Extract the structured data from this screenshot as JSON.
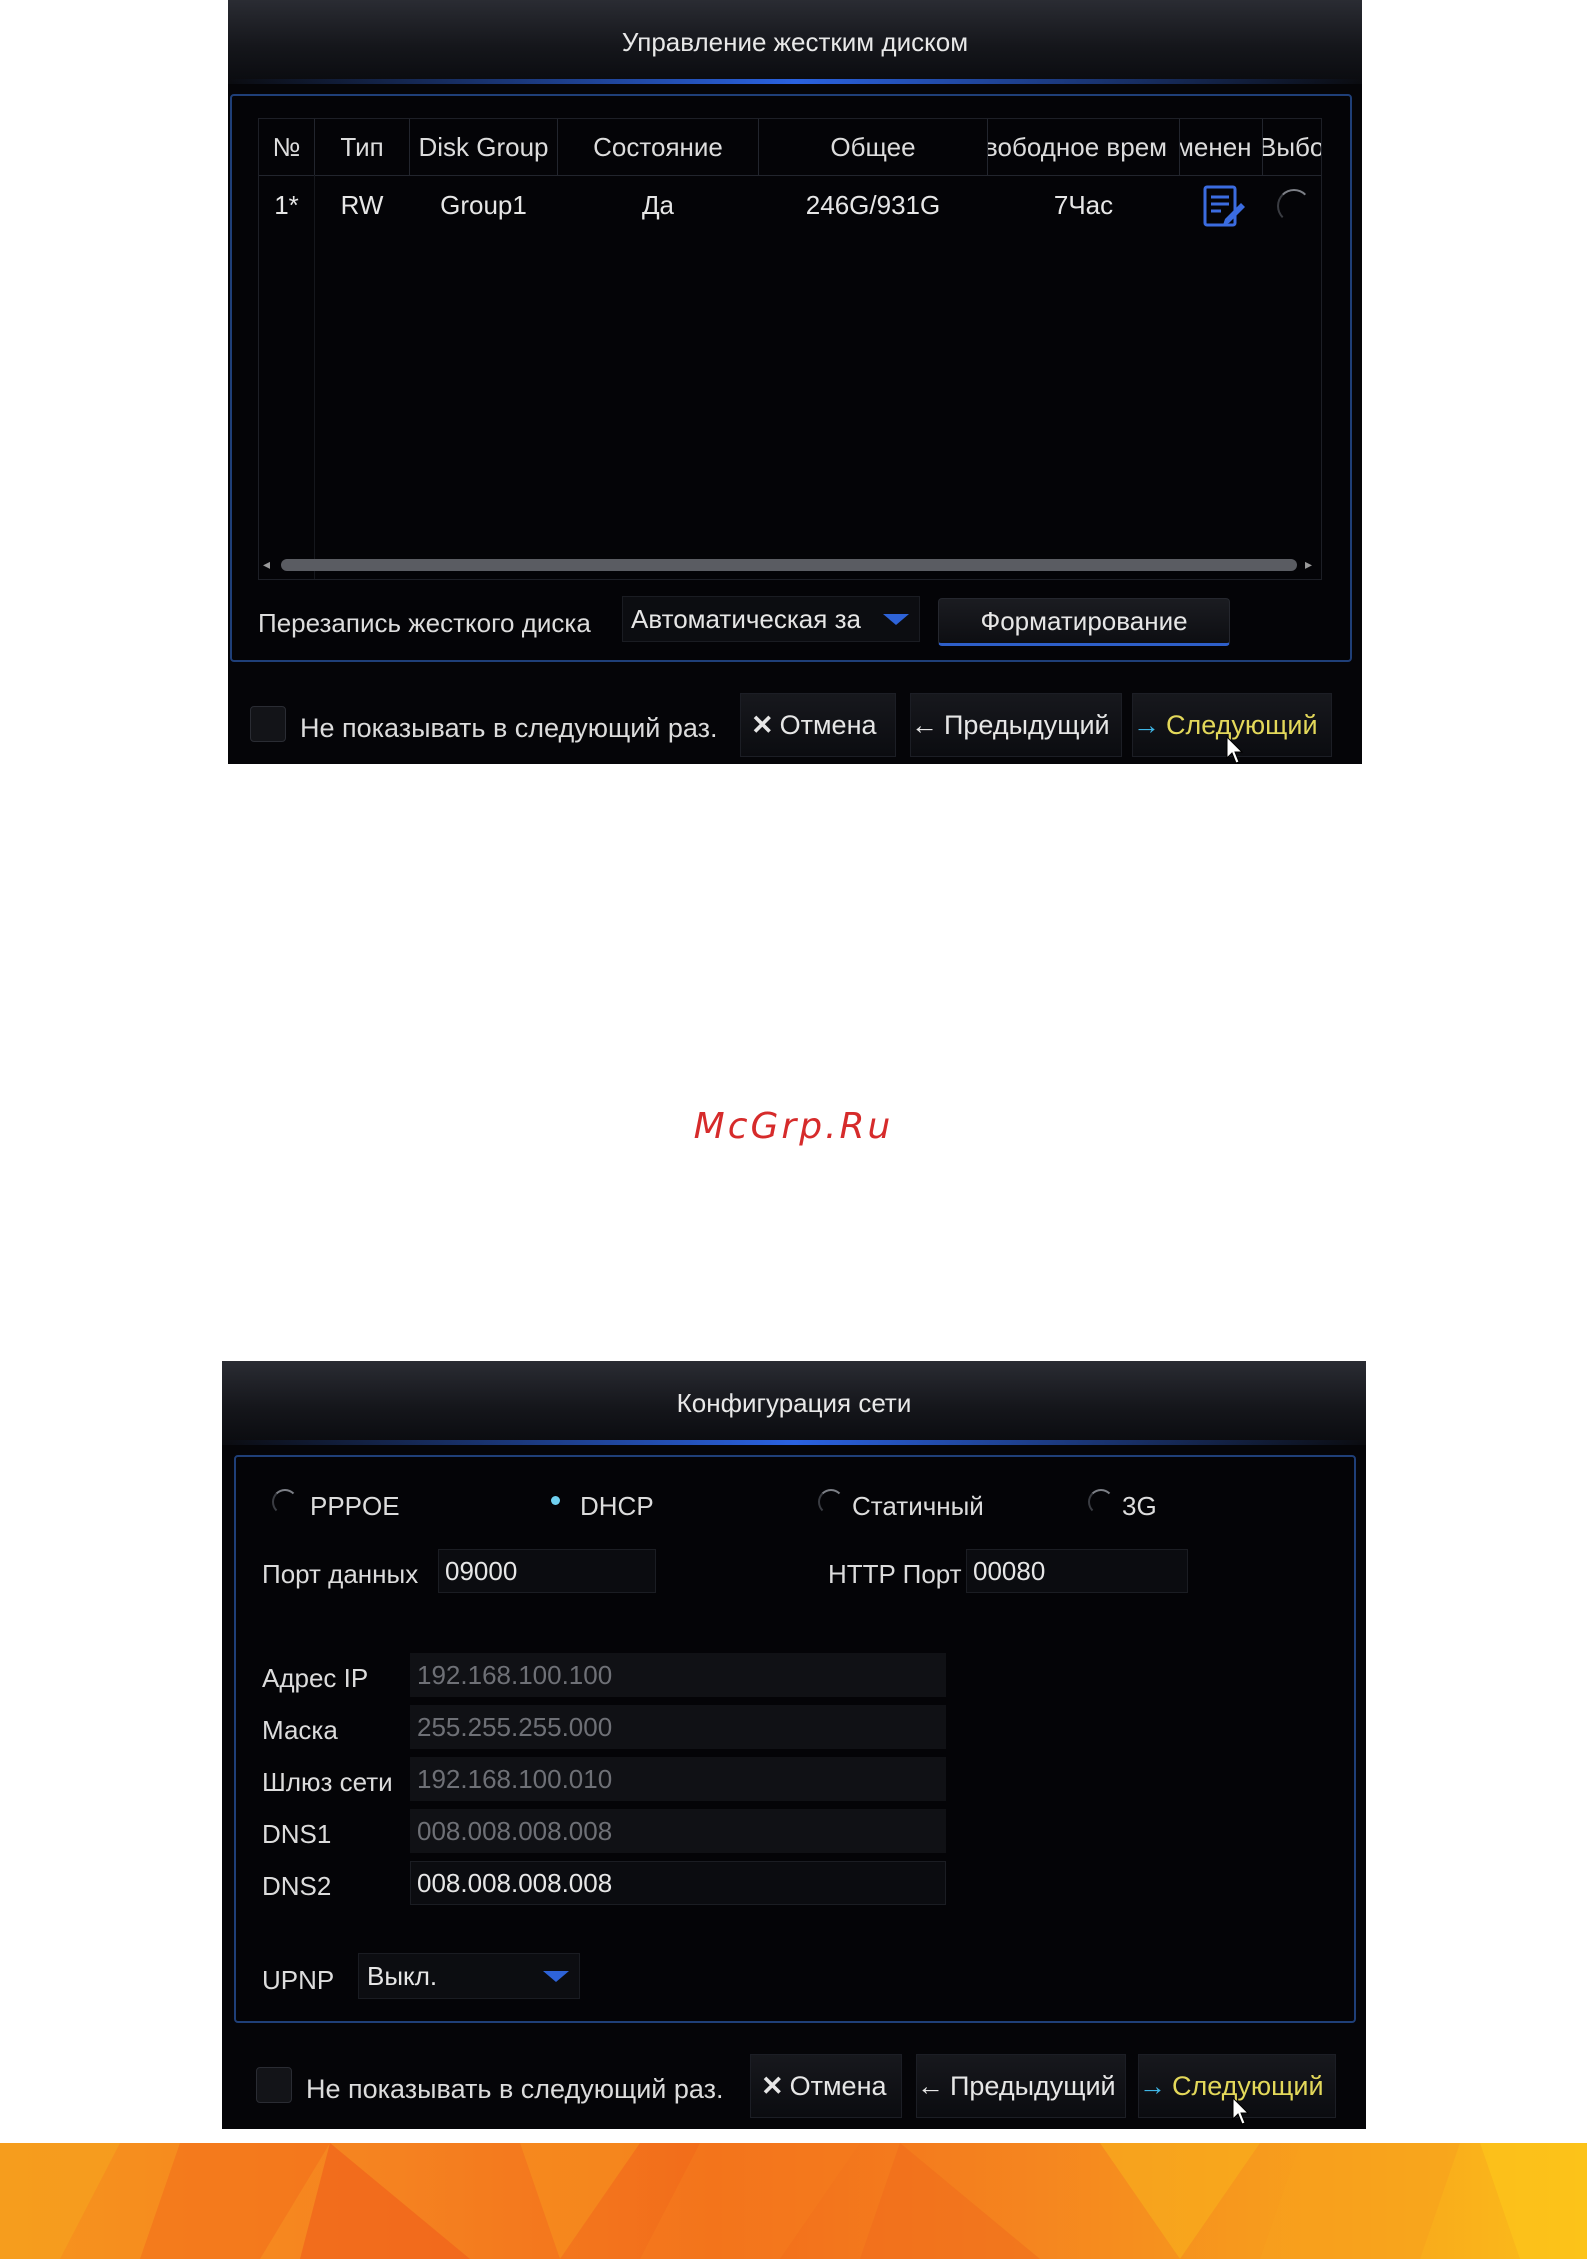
{
  "disk_screen": {
    "title": "Управление жестким диском",
    "columns": [
      "№",
      "Тип",
      "Disk Group",
      "Состояние",
      "Общее",
      "вободное врем",
      "менен",
      "Выбо"
    ],
    "rows": [
      {
        "num": "1*",
        "type": "RW",
        "group": "Group1",
        "state": "Да",
        "total": "246G/931G",
        "free_time": "7Час",
        "edit_icon": "edit-document-icon"
      }
    ],
    "overwrite_label": "Перезапись жесткого диска",
    "overwrite_value": "Автоматическая за",
    "format_button": "Форматирование",
    "footer": {
      "dont_show": "Не показывать в следующий раз.",
      "cancel": "Отмена",
      "prev": "Предыдущий",
      "next": "Следующий"
    }
  },
  "watermark": "McGrp.Ru",
  "network_screen": {
    "title": "Конфигурация сети",
    "modes": [
      {
        "label": "PPPOE",
        "selected": false
      },
      {
        "label": "DHCP",
        "selected": true
      },
      {
        "label": "Статичный",
        "selected": false
      },
      {
        "label": "3G",
        "selected": false
      }
    ],
    "data_port_label": "Порт данных",
    "data_port_value": "09000",
    "http_port_label": "HTTP Порт",
    "http_port_value": "00080",
    "ip_label": "Адрес IP",
    "ip_value": "192.168.100.100",
    "mask_label": "Маска",
    "mask_value": "255.255.255.000",
    "gateway_label": "Шлюз сети",
    "gateway_value": "192.168.100.010",
    "dns1_label": "DNS1",
    "dns1_value": "008.008.008.008",
    "dns2_label": "DNS2",
    "dns2_value": "008.008.008.008",
    "upnp_label": "UPNP",
    "upnp_value": "Выкл.",
    "footer": {
      "dont_show": "Не показывать в следующий раз.",
      "cancel": "Отмена",
      "prev": "Предыдущий",
      "next": "Следующий"
    }
  },
  "colors": {
    "accent_blue": "#2e63d8",
    "next_text": "#e3d85a",
    "next_arrow": "#3fb6e6",
    "watermark": "#d62b2b",
    "banner_orange": "#f58220"
  }
}
